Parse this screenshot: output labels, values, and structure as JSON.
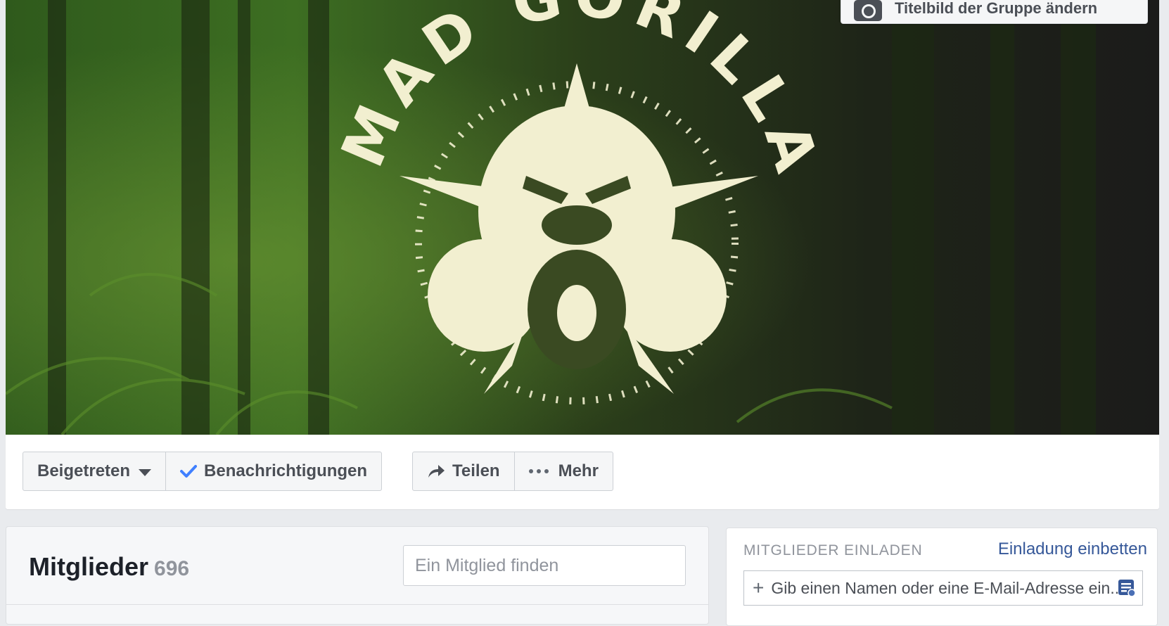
{
  "cover": {
    "logo_text": "MAD GORILLA",
    "change_button_label": "Titelbild der Gruppe ändern"
  },
  "actions": {
    "joined_label": "Beigetreten",
    "notifications_label": "Benachrichtigungen",
    "share_label": "Teilen",
    "more_label": "Mehr"
  },
  "members": {
    "title": "Mitglieder",
    "count": "696",
    "search_placeholder": "Ein Mitglied finden"
  },
  "invite": {
    "title": "MITGLIEDER EINLADEN",
    "embed_link": "Einladung einbetten",
    "input_placeholder": "Gib einen Namen oder eine E-Mail-Adresse ein..."
  },
  "colors": {
    "link": "#365899",
    "button_text": "#4b4f56",
    "check": "#4080ff",
    "logo": "#f2efd0"
  }
}
